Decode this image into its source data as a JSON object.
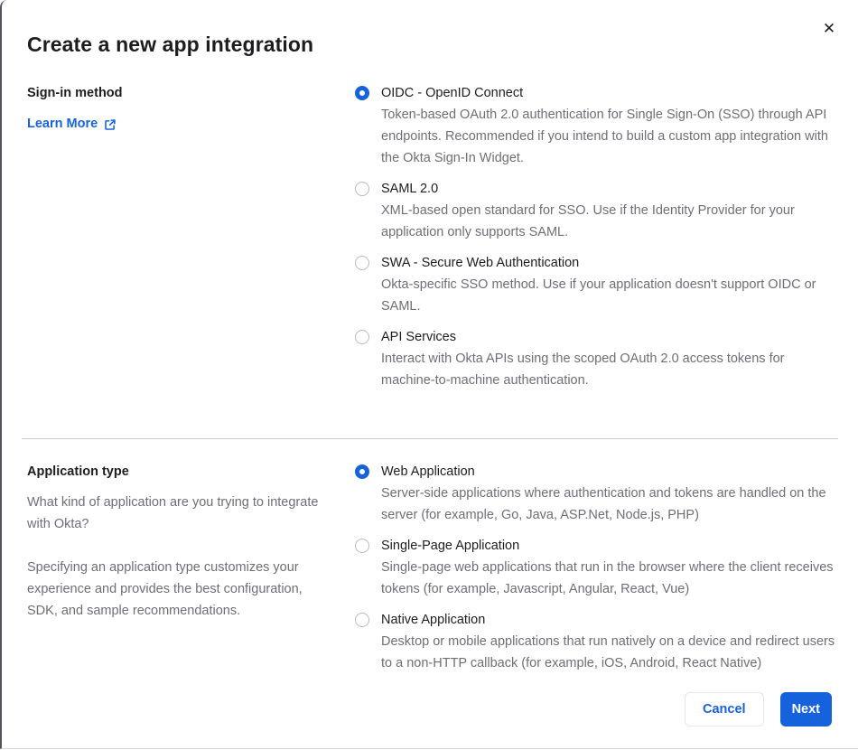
{
  "colors": {
    "primary_blue": "#1662dd",
    "text_dark": "#1d1d21",
    "text_gray": "#6e6e78"
  },
  "dialog": {
    "title": "Create a new app integration",
    "close_glyph": "✕"
  },
  "sign_in_section": {
    "label": "Sign-in method",
    "learn_more_label": "Learn More",
    "options": [
      {
        "label": "OIDC - OpenID Connect",
        "description": "Token-based OAuth 2.0 authentication for Single Sign-On (SSO) through API endpoints. Recommended if you intend to build a custom app integration with the Okta Sign-In Widget.",
        "selected": true
      },
      {
        "label": "SAML 2.0",
        "description": "XML-based open standard for SSO. Use if the Identity Provider for your application only supports SAML.",
        "selected": false
      },
      {
        "label": "SWA - Secure Web Authentication",
        "description": "Okta-specific SSO method. Use if your application doesn't support OIDC or SAML.",
        "selected": false
      },
      {
        "label": "API Services",
        "description": "Interact with Okta APIs using the scoped OAuth 2.0 access tokens for machine-to-machine authentication.",
        "selected": false
      }
    ]
  },
  "app_type_section": {
    "label": "Application type",
    "paragraph_1": "What kind of application are you trying to integrate with Okta?",
    "paragraph_2": "Specifying an application type customizes your experience and provides the best configuration, SDK, and sample recommendations.",
    "options": [
      {
        "label": "Web Application",
        "description": "Server-side applications where authentication and tokens are handled on the server (for example, Go, Java, ASP.Net, Node.js, PHP)",
        "selected": true
      },
      {
        "label": "Single-Page Application",
        "description": "Single-page web applications that run in the browser where the client receives tokens (for example, Javascript, Angular, React, Vue)",
        "selected": false
      },
      {
        "label": "Native Application",
        "description": "Desktop or mobile applications that run natively on a device and redirect users to a non-HTTP callback (for example, iOS, Android, React Native)",
        "selected": false
      }
    ]
  },
  "footer": {
    "cancel_label": "Cancel",
    "next_label": "Next"
  }
}
